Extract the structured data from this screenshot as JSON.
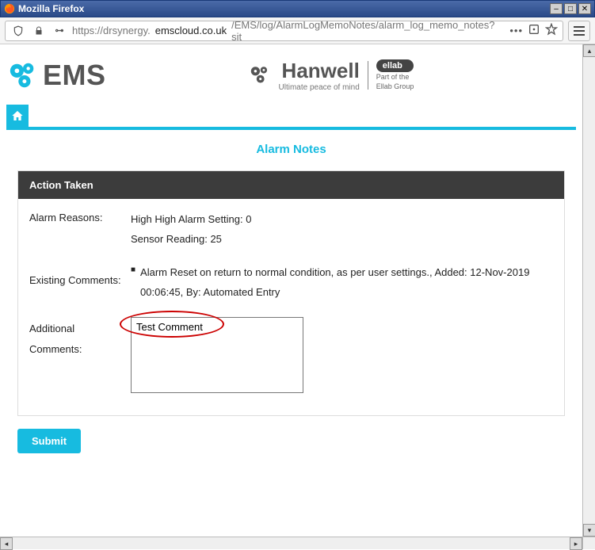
{
  "window": {
    "title": "Mozilla Firefox"
  },
  "url": {
    "prefix": "https://drsynergy.",
    "host": "emscloud.co.uk",
    "path": "/EMS/log/AlarmLogMemoNotes/alarm_log_memo_notes?sit"
  },
  "brand": {
    "ems": "EMS",
    "hanwell_name": "Hanwell",
    "hanwell_sub": "Ultimate peace of mind",
    "ellab_badge": "ellab",
    "ellab_sub1": "Part of the",
    "ellab_sub2": "Ellab Group"
  },
  "page": {
    "title": "Alarm Notes"
  },
  "panel": {
    "heading": "Action Taken",
    "alarm_reasons_label": "Alarm Reasons:",
    "alarm_reasons_line1": "High High Alarm Setting: 0",
    "alarm_reasons_line2": "Sensor Reading: 25",
    "existing_label": "Existing Comments:",
    "existing_text": "Alarm Reset on return to normal condition, as per user settings., Added: 12-Nov-2019 00:06:45, By: Automated Entry",
    "additional_label_line1": "Additional",
    "additional_label_line2": "Comments:",
    "additional_value": "Test Comment"
  },
  "buttons": {
    "submit": "Submit"
  }
}
